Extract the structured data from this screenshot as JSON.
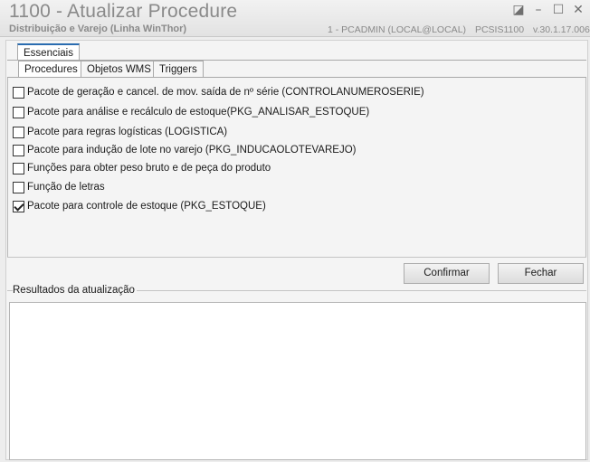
{
  "window": {
    "title": "1100 - Atualizar Procedure",
    "subtitle": "Distribuição e Varejo (Linha WinThor)",
    "user_info": "1 - PCADMIN (LOCAL@LOCAL)",
    "routine": "PCSIS1100",
    "version": "v.30.1.17.006",
    "controls": {
      "restore": "◪",
      "minimize": "–",
      "maximize": "☐",
      "close": "✕"
    }
  },
  "outer_tabs": [
    {
      "label": "Essenciais"
    }
  ],
  "inner_tabs": [
    {
      "label": "Procedures"
    },
    {
      "label": "Objetos WMS"
    },
    {
      "label": "Triggers"
    }
  ],
  "procedures": [
    {
      "label": "Pacote de geração e cancel. de mov. saída de nº série (CONTROLANUMEROSERIE)",
      "checked": false
    },
    {
      "label": "Pacote para análise e recálculo de estoque(PKG_ANALISAR_ESTOQUE)",
      "checked": false
    },
    {
      "label": "Pacote para regras logísticas (LOGISTICA)",
      "checked": false
    },
    {
      "label": "Pacote para indução de lote no varejo (PKG_INDUCAOLOTEVAREJO)",
      "checked": false
    },
    {
      "label": "Funções para obter peso bruto e de peça do produto",
      "checked": false
    },
    {
      "label": "Função de letras",
      "checked": false
    },
    {
      "label": "Pacote para controle de estoque (PKG_ESTOQUE)",
      "checked": true
    }
  ],
  "buttons": {
    "confirm": "Confirmar",
    "close": "Fechar"
  },
  "results": {
    "label": "Resultados da atualização",
    "value": ""
  }
}
